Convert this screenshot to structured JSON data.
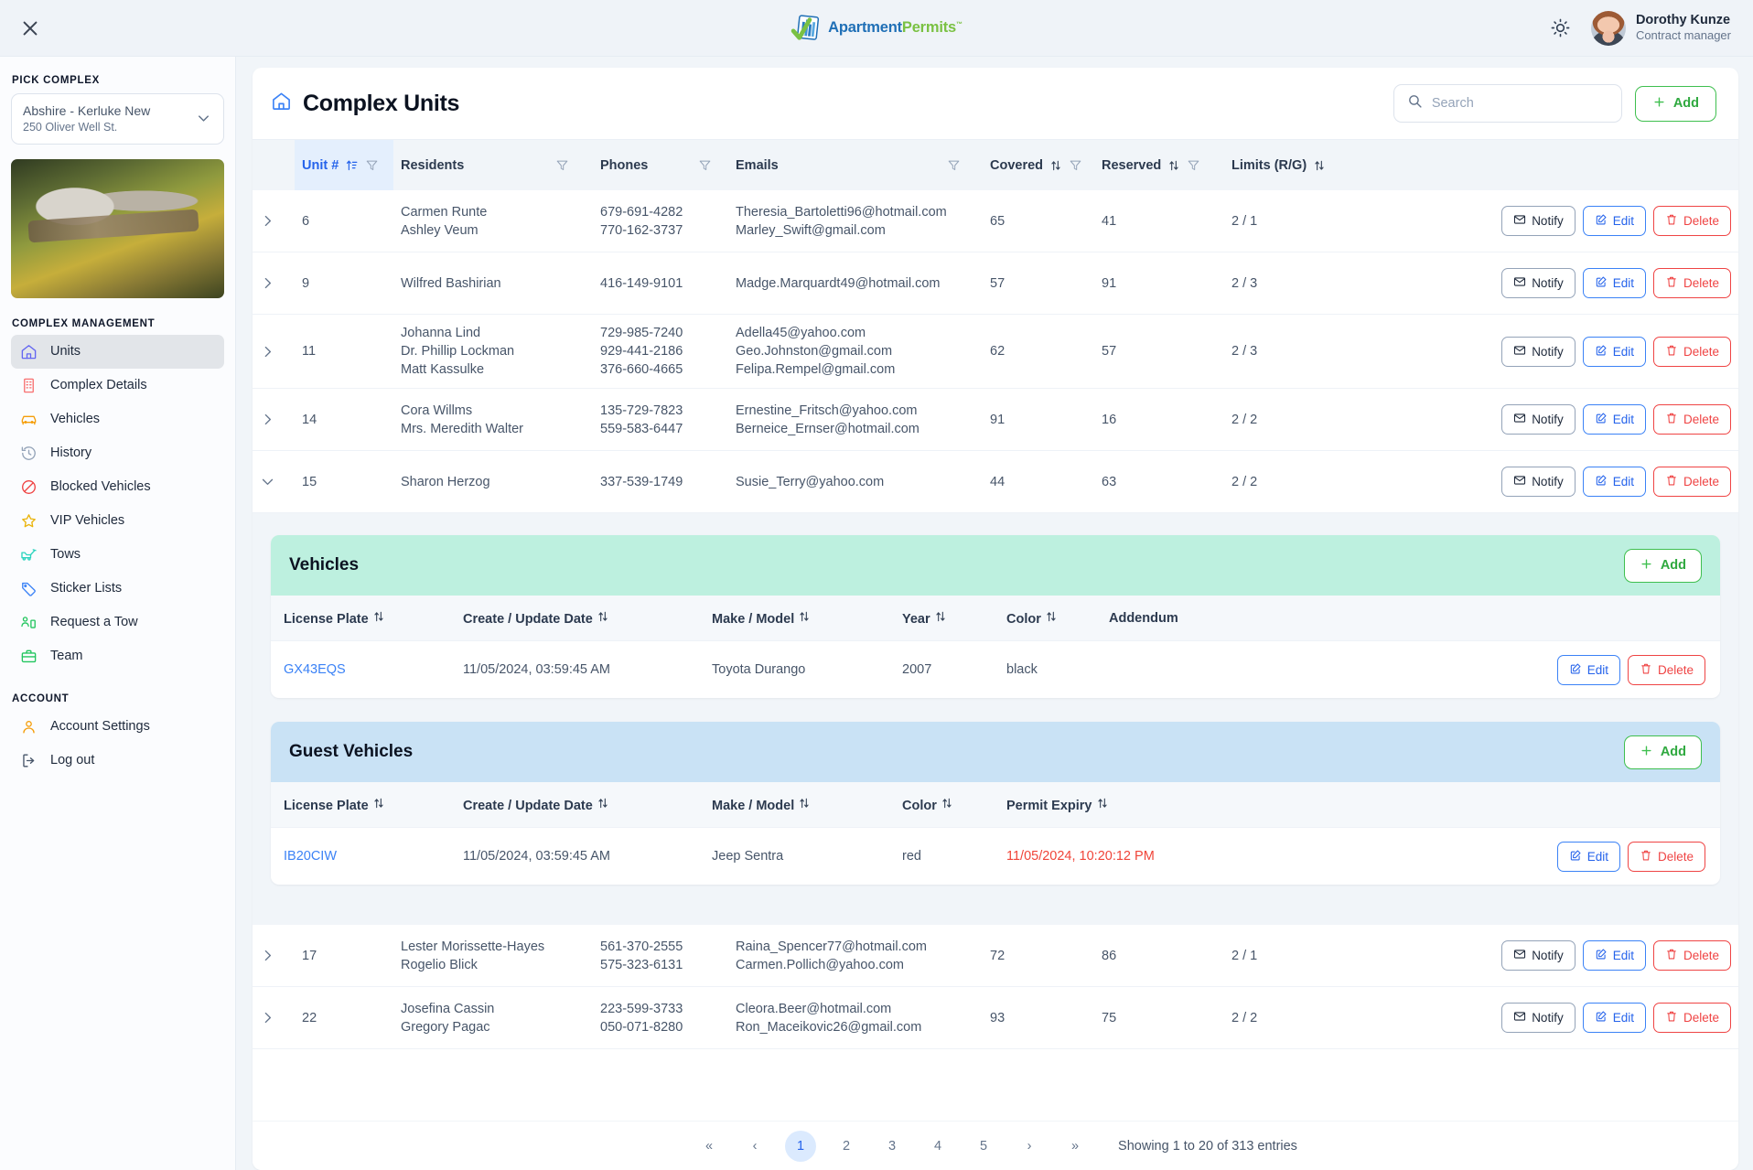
{
  "topbar": {
    "close_label": "×",
    "logo_part1": "Apartment",
    "logo_part2": "Permits",
    "logo_tm": "™",
    "theme_icon": "sun-icon",
    "user_name": "Dorothy Kunze",
    "user_role": "Contract manager"
  },
  "sidebar": {
    "pick_complex_label": "PICK COMPLEX",
    "selected_complex": {
      "name": "Abshire - Kerluke New",
      "address": "250 Oliver Well St."
    },
    "complex_management_label": "COMPLEX MANAGEMENT",
    "management_items": [
      {
        "label": "Units",
        "icon": "home-icon",
        "color": "#6366f1",
        "active": true
      },
      {
        "label": "Complex Details",
        "icon": "building-icon",
        "color": "#f87171",
        "active": false
      },
      {
        "label": "Vehicles",
        "icon": "car-icon",
        "color": "#f59e0b",
        "active": false
      },
      {
        "label": "History",
        "icon": "history-icon",
        "color": "#94a3b8",
        "active": false
      },
      {
        "label": "Blocked Vehicles",
        "icon": "no-entry-icon",
        "color": "#ef4444",
        "active": false
      },
      {
        "label": "VIP Vehicles",
        "icon": "star-icon",
        "color": "#eab308",
        "active": false
      },
      {
        "label": "Tows",
        "icon": "tow-truck-icon",
        "color": "#2dd4bf",
        "active": false
      },
      {
        "label": "Sticker Lists",
        "icon": "tag-icon",
        "color": "#3b82f6",
        "active": false
      },
      {
        "label": "Request a Tow",
        "icon": "person-request-icon",
        "color": "#22c55e",
        "active": false
      },
      {
        "label": "Team",
        "icon": "briefcase-icon",
        "color": "#22c55e",
        "active": false
      }
    ],
    "account_label": "ACCOUNT",
    "account_items": [
      {
        "label": "Account Settings",
        "icon": "user-icon",
        "color": "#f59e0b"
      },
      {
        "label": "Log out",
        "icon": "logout-icon",
        "color": "#475569"
      }
    ]
  },
  "page": {
    "title": "Complex Units",
    "home_icon": "home-icon",
    "search_placeholder": "Search",
    "search_value": "",
    "add_label": "Add"
  },
  "table": {
    "columns": [
      {
        "key": "unit",
        "label": "Unit #",
        "sortable": true,
        "filterable": true,
        "selected": true
      },
      {
        "key": "residents",
        "label": "Residents",
        "sortable": false,
        "filterable": true,
        "selected": false
      },
      {
        "key": "phones",
        "label": "Phones",
        "sortable": false,
        "filterable": true,
        "selected": false
      },
      {
        "key": "emails",
        "label": "Emails",
        "sortable": false,
        "filterable": true,
        "selected": false
      },
      {
        "key": "covered",
        "label": "Covered",
        "sortable": true,
        "filterable": true,
        "selected": false
      },
      {
        "key": "reserved",
        "label": "Reserved",
        "sortable": true,
        "filterable": true,
        "selected": false
      },
      {
        "key": "limits",
        "label": "Limits (R/G)",
        "sortable": true,
        "filterable": false,
        "selected": false
      }
    ],
    "row_actions": {
      "notify": "Notify",
      "edit": "Edit",
      "delete": "Delete"
    },
    "rows": [
      {
        "unit": "6",
        "expanded": false,
        "residents": [
          "Carmen Runte",
          "Ashley Veum"
        ],
        "phones": [
          "679-691-4282",
          "770-162-3737"
        ],
        "emails": [
          "Theresia_Bartoletti96@hotmail.com",
          "Marley_Swift@gmail.com"
        ],
        "covered": "65",
        "reserved": "41",
        "limits": "2 / 1"
      },
      {
        "unit": "9",
        "expanded": false,
        "residents": [
          "Wilfred Bashirian"
        ],
        "phones": [
          "416-149-9101"
        ],
        "emails": [
          "Madge.Marquardt49@hotmail.com"
        ],
        "covered": "57",
        "reserved": "91",
        "limits": "2 / 3"
      },
      {
        "unit": "11",
        "expanded": false,
        "residents": [
          "Johanna Lind",
          "Dr. Phillip Lockman",
          "Matt Kassulke"
        ],
        "phones": [
          "729-985-7240",
          "929-441-2186",
          "376-660-4665"
        ],
        "emails": [
          "Adella45@yahoo.com",
          "Geo.Johnston@gmail.com",
          "Felipa.Rempel@gmail.com"
        ],
        "covered": "62",
        "reserved": "57",
        "limits": "2 / 3"
      },
      {
        "unit": "14",
        "expanded": false,
        "residents": [
          "Cora Willms",
          "Mrs. Meredith Walter"
        ],
        "phones": [
          "135-729-7823",
          "559-583-6447"
        ],
        "emails": [
          "Ernestine_Fritsch@yahoo.com",
          "Berneice_Ernser@hotmail.com"
        ],
        "covered": "91",
        "reserved": "16",
        "limits": "2 / 2"
      },
      {
        "unit": "15",
        "expanded": true,
        "residents": [
          "Sharon Herzog"
        ],
        "phones": [
          "337-539-1749"
        ],
        "emails": [
          "Susie_Terry@yahoo.com"
        ],
        "covered": "44",
        "reserved": "63",
        "limits": "2 / 2"
      },
      {
        "unit": "17",
        "expanded": false,
        "residents": [
          "Lester Morissette-Hayes",
          "Rogelio Blick"
        ],
        "phones": [
          "561-370-2555",
          "575-323-6131"
        ],
        "emails": [
          "Raina_Spencer77@hotmail.com",
          "Carmen.Pollich@yahoo.com"
        ],
        "covered": "72",
        "reserved": "86",
        "limits": "2 / 1"
      },
      {
        "unit": "22",
        "expanded": false,
        "residents": [
          "Josefina Cassin",
          "Gregory Pagac"
        ],
        "phones": [
          "223-599-3733",
          "050-071-8280"
        ],
        "emails": [
          "Cleora.Beer@hotmail.com",
          "Ron_Maceikovic26@gmail.com"
        ],
        "covered": "93",
        "reserved": "75",
        "limits": "2 / 2"
      }
    ]
  },
  "detail": {
    "vehicles": {
      "title": "Vehicles",
      "add_label": "Add",
      "header_color": "#bdf0df",
      "columns": [
        "License Plate",
        "Create / Update Date",
        "Make / Model",
        "Year",
        "Color",
        "Addendum"
      ],
      "rows": [
        {
          "plate": "GX43EQS",
          "date": "11/05/2024, 03:59:45 AM",
          "make_model": "Toyota Durango",
          "year": "2007",
          "color": "black",
          "addendum": ""
        }
      ]
    },
    "guest_vehicles": {
      "title": "Guest Vehicles",
      "add_label": "Add",
      "header_color": "#c9e2f5",
      "columns": [
        "License Plate",
        "Create / Update Date",
        "Make / Model",
        "Color",
        "Permit Expiry"
      ],
      "rows": [
        {
          "plate": "IB20CIW",
          "date": "11/05/2024, 03:59:45 AM",
          "make_model": "Jeep Sentra",
          "color": "red",
          "permit_expiry": "11/05/2024, 10:20:12 PM",
          "expired": true
        }
      ]
    },
    "actions": {
      "edit": "Edit",
      "delete": "Delete"
    }
  },
  "pagination": {
    "first": "«",
    "prev": "‹",
    "next": "›",
    "last": "»",
    "pages": [
      "1",
      "2",
      "3",
      "4",
      "5"
    ],
    "current": "1",
    "info": "Showing 1 to 20 of 313 entries"
  }
}
